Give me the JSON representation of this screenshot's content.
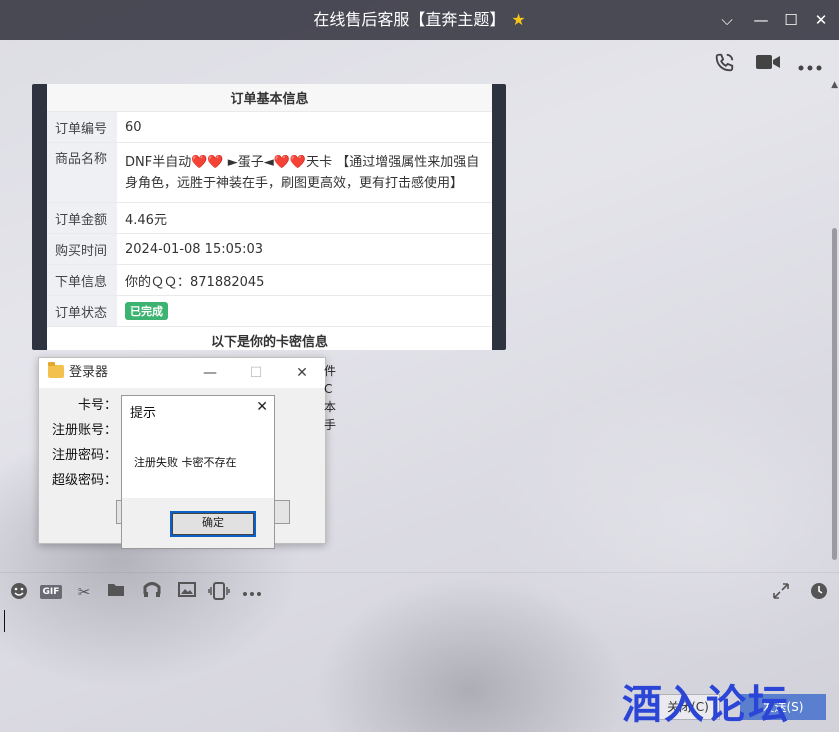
{
  "window": {
    "title": "在线售后客服【直奔主题】",
    "title_star": "★",
    "controls": [
      "⌵",
      "—",
      "☐",
      "✕"
    ]
  },
  "top_icons": [
    "phone-icon",
    "video-icon",
    "more-icon"
  ],
  "order_card": {
    "header": "订单基本信息",
    "rows": [
      {
        "key": "订单编号",
        "value": "60"
      },
      {
        "key": "商品名称",
        "value": "DNF半自动❤️❤️ ►蛋子◄❤️❤️天卡 【通过增强属性来加强自身角色，远胜于神装在手，刷图更高效，更有打击感使用】"
      },
      {
        "key": "订单金额",
        "value": "4.46元"
      },
      {
        "key": "购买时间",
        "value": "2024-01-08 15:05:03"
      },
      {
        "key": "下单信息",
        "value": "你的ＱＱ：871882045"
      },
      {
        "key": "订单状态",
        "value": "已完成",
        "status_color": "#3cb371"
      }
    ],
    "footer": "以下是你的卡密信息"
  },
  "login_window": {
    "title": "登录器",
    "labels": {
      "card": "卡号：",
      "account": "注册账号：",
      "password": "注册密码：",
      "super_password": "超级密码："
    }
  },
  "side_text": [
    "件",
    "C",
    "本",
    "手"
  ],
  "alert": {
    "title": "提示",
    "message": "注册失败 卡密不存在",
    "ok": "确定"
  },
  "toolbar": [
    "smile-icon",
    "gif-icon",
    "scissors-icon",
    "folder-icon",
    "music-icon",
    "image-icon",
    "shake-icon",
    "more-icon",
    "expand-icon",
    "history-icon"
  ],
  "bottom": {
    "close": "关闭(C)",
    "send": "发送(S)",
    "watermark": "酒入论坛"
  }
}
